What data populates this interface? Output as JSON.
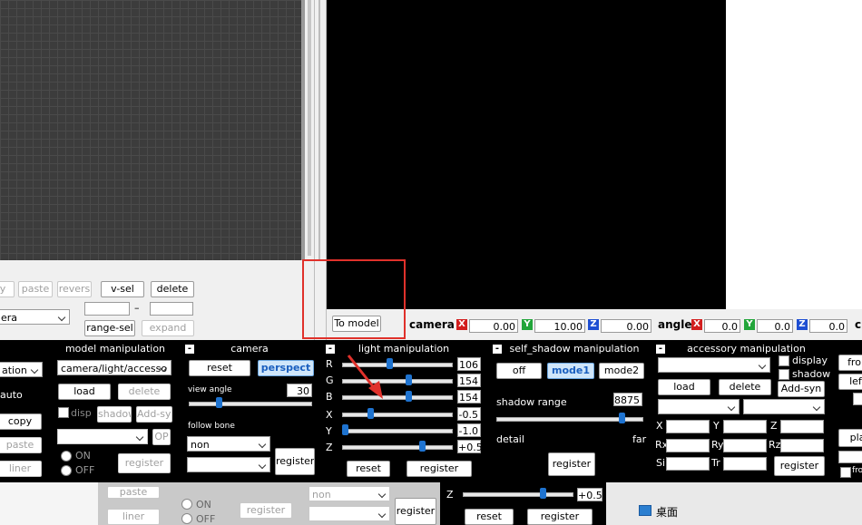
{
  "timeline": {
    "copy_label": "y",
    "paste_label": "paste",
    "reverse_label": "revers",
    "vsel_label": "v-sel",
    "delete_label": "delete",
    "range_dash": "–",
    "camera_select": "era",
    "range_sel_label": "range-sel",
    "expand_label": "expand"
  },
  "viewport": {
    "to_model_label": "To model"
  },
  "camera_bar": {
    "camera_label": "camera",
    "cam_x": "0.00",
    "cam_y": "10.00",
    "cam_z": "0.00",
    "angle_label": "angle",
    "ang_x": "0.0",
    "ang_y": "0.0",
    "ang_z": "0.0",
    "x": "X",
    "y": "Y",
    "z": "Z",
    "trailing": "c"
  },
  "left_panel": {
    "mode_select": "ation",
    "auto_label": "auto",
    "copy_label": "copy",
    "paste_label": "paste",
    "liner_label": "liner"
  },
  "model_manipulation": {
    "title": "model manipulation",
    "select": "camera/light/accesso",
    "load_label": "load",
    "delete_label": "delete",
    "disp_label": "disp",
    "shadow_label": "shadow",
    "addsyn_label": "Add-syn",
    "op_label": "OP",
    "on_label": "ON",
    "off_label": "OFF",
    "register_label": "register"
  },
  "camera": {
    "minus": "-",
    "title": "camera",
    "reset_label": "reset",
    "perspect_label": "perspect",
    "view_angle_label": "view angle",
    "view_angle": "30",
    "view_angle_value": 30,
    "follow_bone_label": "follow bone",
    "follow_select": "non",
    "register_label": "register"
  },
  "light": {
    "minus": "-",
    "title": "light manipulation",
    "r_label": "R",
    "r_value": "106",
    "g_label": "G",
    "g_value": "154",
    "b_label": "B",
    "b_value": "154",
    "x_label": "X",
    "x_value": "-0.5",
    "y_label": "Y",
    "y_value": "-1.0",
    "z_label": "Z",
    "z_value": "+0.5",
    "reset_label": "reset",
    "register_label": "register"
  },
  "self_shadow": {
    "minus": "-",
    "title": "self_shadow manipulation",
    "off_label": "off",
    "mode1_label": "mode1",
    "mode2_label": "mode2",
    "range_label": "shadow range",
    "range_value": "8875",
    "detail_label": "detail",
    "far_label": "far",
    "register_label": "register"
  },
  "accessory": {
    "minus": "-",
    "title": "accessory manipulation",
    "display_label": "display",
    "shadow_label": "shadow",
    "load_label": "load",
    "delete_label": "delete",
    "addsyn_label": "Add-syn",
    "x": "X",
    "y": "Y",
    "z": "Z",
    "rx": "Rx",
    "ry": "Ry",
    "rz": "Rz",
    "si": "Si",
    "tr": "Tr",
    "register_label": "register"
  },
  "right_edge": {
    "front_label": "fron",
    "left_label": "left",
    "play_label": "pla",
    "fr_label": "fro"
  },
  "behind": {
    "paste_label": "paste",
    "liner_label": "liner",
    "on_label": "ON",
    "off_label": "OFF",
    "register1": "register",
    "non_select": "non",
    "register2": "register",
    "z_label": "Z",
    "z_value": "+0.5",
    "reset_label": "reset",
    "register3": "register",
    "desktop_label": "桌面"
  },
  "colors": {
    "highlight_box": "#e0312b",
    "arrow": "#e0312b",
    "panel_bg": "#000000",
    "slider_thumb": "#1e73d0"
  }
}
